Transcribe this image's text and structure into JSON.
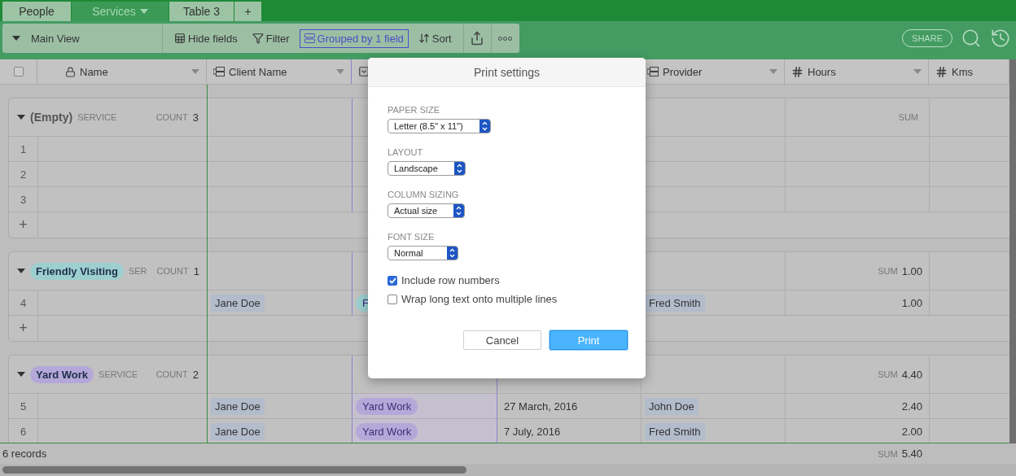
{
  "tabs": [
    {
      "label": "People",
      "selected": false,
      "menu": false
    },
    {
      "label": "Services",
      "selected": true,
      "menu": true
    },
    {
      "label": "Table 3",
      "selected": false,
      "menu": false
    }
  ],
  "add_tab": "+",
  "toolbar": {
    "view": "Main View",
    "tools": [
      {
        "kind": "hide",
        "label": "Hide fields",
        "active": false
      },
      {
        "kind": "filter",
        "label": "Filter",
        "active": false
      },
      {
        "kind": "group",
        "label": "Grouped by 1 field",
        "active": true
      },
      {
        "kind": "sort",
        "label": "Sort",
        "active": false
      }
    ],
    "share": "SHARE"
  },
  "table": {
    "select_all": {
      "checked": false
    },
    "columns": [
      {
        "kind": "lock",
        "label": "Name",
        "menu": true
      },
      {
        "kind": "link",
        "label": "Client Name",
        "menu": true
      },
      {
        "kind": "select"
      },
      {
        "kind": "hidden"
      },
      {
        "kind": "link",
        "label": "Provider",
        "menu": true
      },
      {
        "kind": "number",
        "label": "Hours",
        "menu": true
      },
      {
        "kind": "number",
        "label": "Kms",
        "menu": false
      }
    ],
    "groups": [
      {
        "kind": "plain",
        "title": "(Empty)",
        "field": "SERVICE",
        "count_label": "COUNT",
        "count": "3",
        "sum_label": "SUM",
        "add": "+",
        "rows": [
          {
            "number": "1"
          },
          {
            "number": "2"
          },
          {
            "number": "3"
          }
        ]
      },
      {
        "kind": "tag",
        "title": "Friendly Visiting",
        "color": "#9dcfd0",
        "field": "SER",
        "count_label": "COUNT",
        "count": "1",
        "sum_label": "SUM",
        "sum": "1.00",
        "add": "+",
        "rows": [
          {
            "number": "4",
            "cells": [
              {
                "kind": "empty"
              },
              {
                "kind": "link",
                "text": "Jane Doe"
              },
              {
                "kind": "tag",
                "text": "F",
                "color": "#9dcfd0"
              },
              {
                "kind": "empty"
              },
              {
                "kind": "link",
                "text": "Fred Smith"
              },
              {
                "kind": "number",
                "text": "1.00"
              },
              {
                "kind": "empty"
              }
            ]
          }
        ]
      },
      {
        "kind": "tag",
        "title": "Yard Work",
        "color": "#b4a8d8",
        "field": "SERVICE",
        "count_label": "COUNT",
        "count": "2",
        "sum_label": "SUM",
        "sum": "4.40",
        "rows": [
          {
            "number": "5",
            "cells": [
              {
                "kind": "empty"
              },
              {
                "kind": "link",
                "text": "Jane Doe"
              },
              {
                "kind": "tag",
                "text": "Yard Work",
                "color": "#b4a8d8"
              },
              {
                "kind": "text",
                "text": "27 March, 2016"
              },
              {
                "kind": "link",
                "text": "John Doe"
              },
              {
                "kind": "number",
                "text": "2.40"
              },
              {
                "kind": "empty"
              }
            ]
          },
          {
            "number": "6",
            "cells": [
              {
                "kind": "empty"
              },
              {
                "kind": "link",
                "text": "Jane Doe"
              },
              {
                "kind": "tag",
                "text": "Yard Work",
                "color": "#b4a8d8"
              },
              {
                "kind": "text",
                "text": "7 July, 2016"
              },
              {
                "kind": "link",
                "text": "Fred Smith"
              },
              {
                "kind": "number",
                "text": "2.00"
              },
              {
                "kind": "empty"
              }
            ]
          }
        ]
      }
    ],
    "footer": {
      "records": "6 records",
      "sum_label": "SUM",
      "sum": "5.40"
    }
  },
  "dialog": {
    "title": "Print settings",
    "settings": [
      {
        "label": "PAPER SIZE",
        "value": "Letter (8.5\" x 11\")"
      },
      {
        "label": "LAYOUT",
        "value": "Landscape"
      },
      {
        "label": "COLUMN SIZING",
        "value": "Actual size"
      },
      {
        "label": "FONT SIZE",
        "value": "Normal"
      }
    ],
    "options": [
      {
        "label": "Include row numbers",
        "checked": true
      },
      {
        "label": "Wrap long text onto multiple lines",
        "checked": false
      }
    ],
    "buttons": [
      {
        "label": "Cancel",
        "primary": false
      },
      {
        "label": "Print",
        "primary": true
      }
    ]
  }
}
